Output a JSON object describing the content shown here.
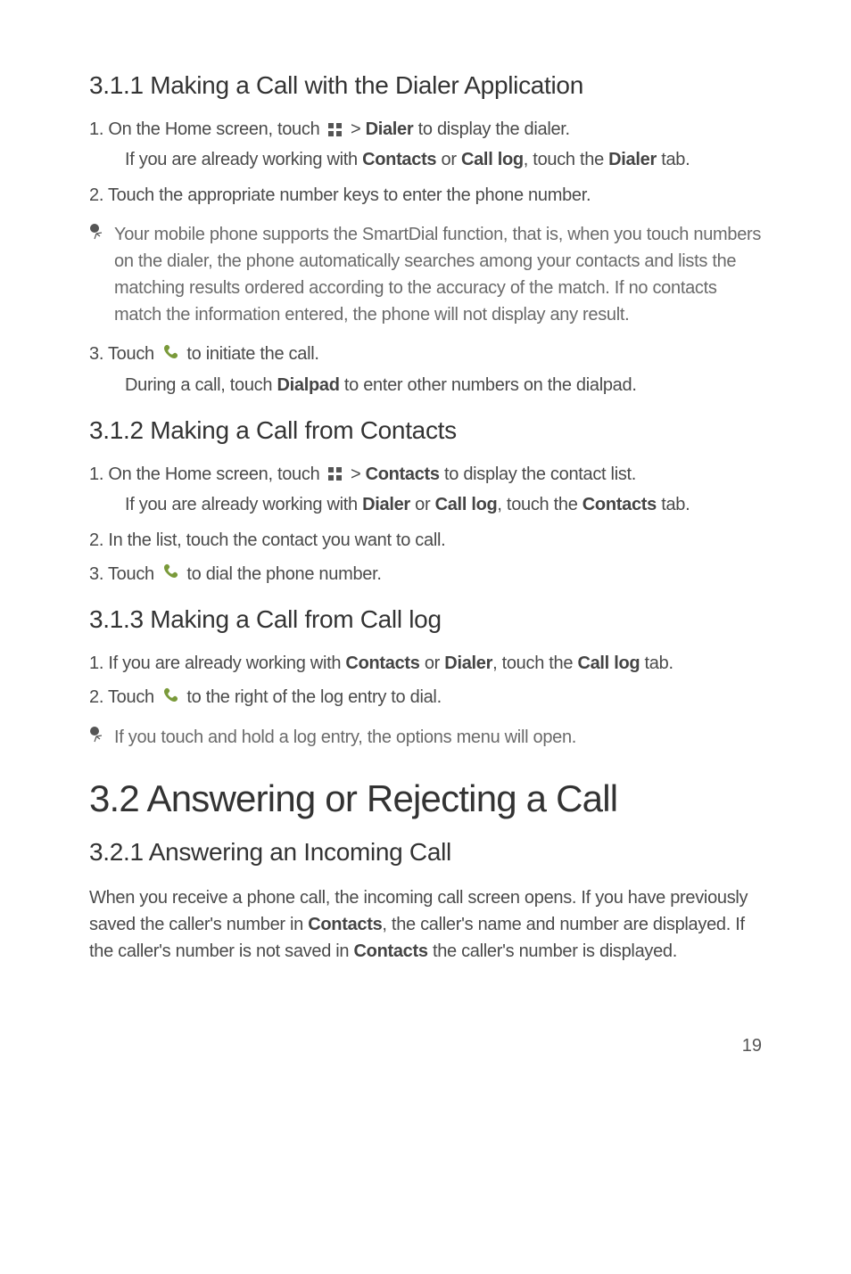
{
  "s311": {
    "heading": "3.1.1  Making a Call with the Dialer Application",
    "step1_prefix": "1. On the Home screen, touch ",
    "step1_mid": " > ",
    "step1_bold": "Dialer",
    "step1_suffix": " to display the dialer.",
    "step1_indent_a": "If you are already working with ",
    "step1_indent_b1": "Contacts",
    "step1_indent_c": " or ",
    "step1_indent_b2": "Call log",
    "step1_indent_d": ", touch the ",
    "step1_indent_b3": "Dialer",
    "step1_indent_e": " tab.",
    "step2": "2. Touch the appropriate number keys to enter the phone number.",
    "note": "Your mobile phone supports the SmartDial function, that is, when you touch numbers on the dialer, the phone automatically searches among your contacts and lists the matching results ordered according to the accuracy of the match. If no contacts match the information entered, the phone will not display any result.",
    "step3_prefix": "3. Touch ",
    "step3_suffix": " to initiate the call.",
    "step3_indent_a": "During a call, touch ",
    "step3_indent_b": "Dialpad",
    "step3_indent_c": " to enter other numbers on the dialpad."
  },
  "s312": {
    "heading": "3.1.2  Making a Call from Contacts",
    "step1_prefix": "1. On the Home screen, touch ",
    "step1_mid": " > ",
    "step1_bold": "Contacts",
    "step1_suffix": " to display the contact list.",
    "step1_indent_a": "If you are already working with ",
    "step1_indent_b1": "Dialer",
    "step1_indent_c": " or ",
    "step1_indent_b2": "Call log",
    "step1_indent_d": ", touch the ",
    "step1_indent_b3": "Contacts",
    "step1_indent_e": " tab.",
    "step2": "2. In the list, touch the contact you want to call.",
    "step3_prefix": "3. Touch ",
    "step3_suffix": " to dial the phone number."
  },
  "s313": {
    "heading": "3.1.3  Making a Call from Call log",
    "step1_a": "1. If you are already working with ",
    "step1_b1": "Contacts",
    "step1_c": " or ",
    "step1_b2": "Dialer",
    "step1_d": ", touch the ",
    "step1_b3": "Call log",
    "step1_e": " tab.",
    "step2_prefix": "2. Touch ",
    "step2_suffix": " to the right of the log entry to dial.",
    "note": "If you touch and hold a log entry, the options menu will open."
  },
  "s32": {
    "heading": "3.2  Answering or Rejecting a Call"
  },
  "s321": {
    "heading": "3.2.1  Answering an Incoming Call",
    "para_a": "When you receive a phone call, the incoming call screen opens. If you have previously saved the caller's number in ",
    "para_b1": "Contacts",
    "para_c": ", the caller's name and number are displayed. If the caller's number is not saved in ",
    "para_b2": "Contacts",
    "para_d": " the caller's number is displayed."
  },
  "page_number": "19"
}
